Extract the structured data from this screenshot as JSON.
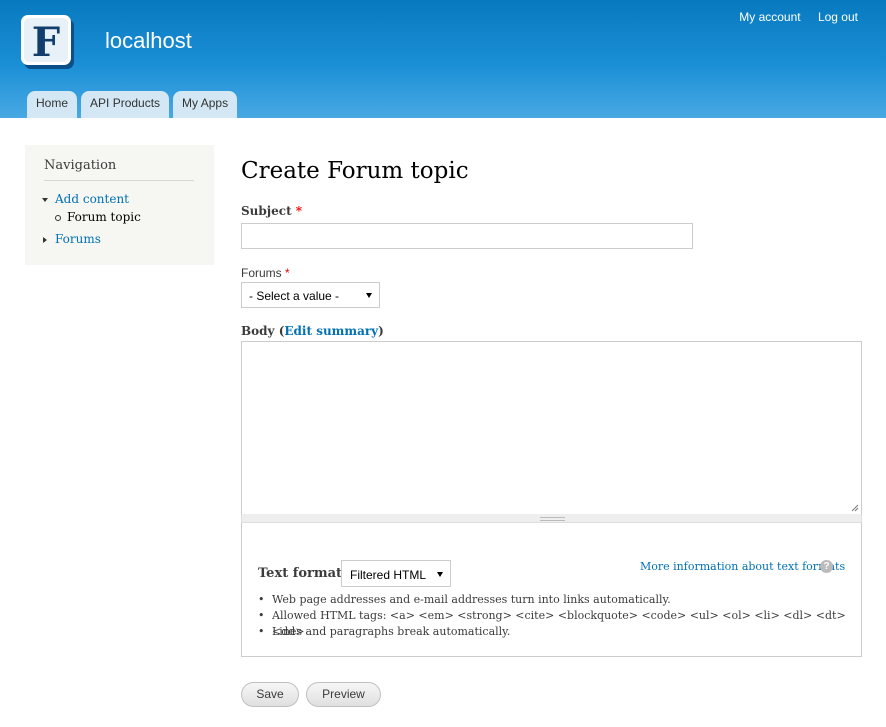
{
  "header": {
    "site_name": "localhost",
    "logo_letter": "F",
    "secondary_menu": [
      "My account",
      "Log out"
    ],
    "tabs": [
      "Home",
      "API Products",
      "My Apps"
    ]
  },
  "sidebar": {
    "title": "Navigation",
    "items": [
      {
        "label": "Add content",
        "expanded": true,
        "children": [
          "Forum topic"
        ]
      },
      {
        "label": "Forums",
        "expanded": false
      }
    ]
  },
  "form": {
    "title": "Create Forum topic",
    "subject_label": "Subject",
    "required_marker": "*",
    "forums_label": "Forums",
    "forums_value": "- Select a value -",
    "body_label_prefix": "Body (",
    "body_edit_summary": "Edit summary",
    "body_label_suffix": ")",
    "text_format_label": "Text format",
    "text_format_value": "Filtered HTML",
    "more_info_link": "More information about text formats",
    "help_icon_glyph": "?",
    "guidelines": [
      "Web page addresses and e-mail addresses turn into links automatically.",
      "Allowed HTML tags: <a> <em> <strong> <cite> <blockquote> <code> <ul> <ol> <li> <dl> <dt> <dd>",
      "Lines and paragraphs break automatically."
    ],
    "save_label": "Save",
    "preview_label": "Preview"
  },
  "colors": {
    "header_top": "#0779bf",
    "header_bottom": "#48a9e3",
    "link": "#0071b3",
    "required": "#e00000"
  }
}
